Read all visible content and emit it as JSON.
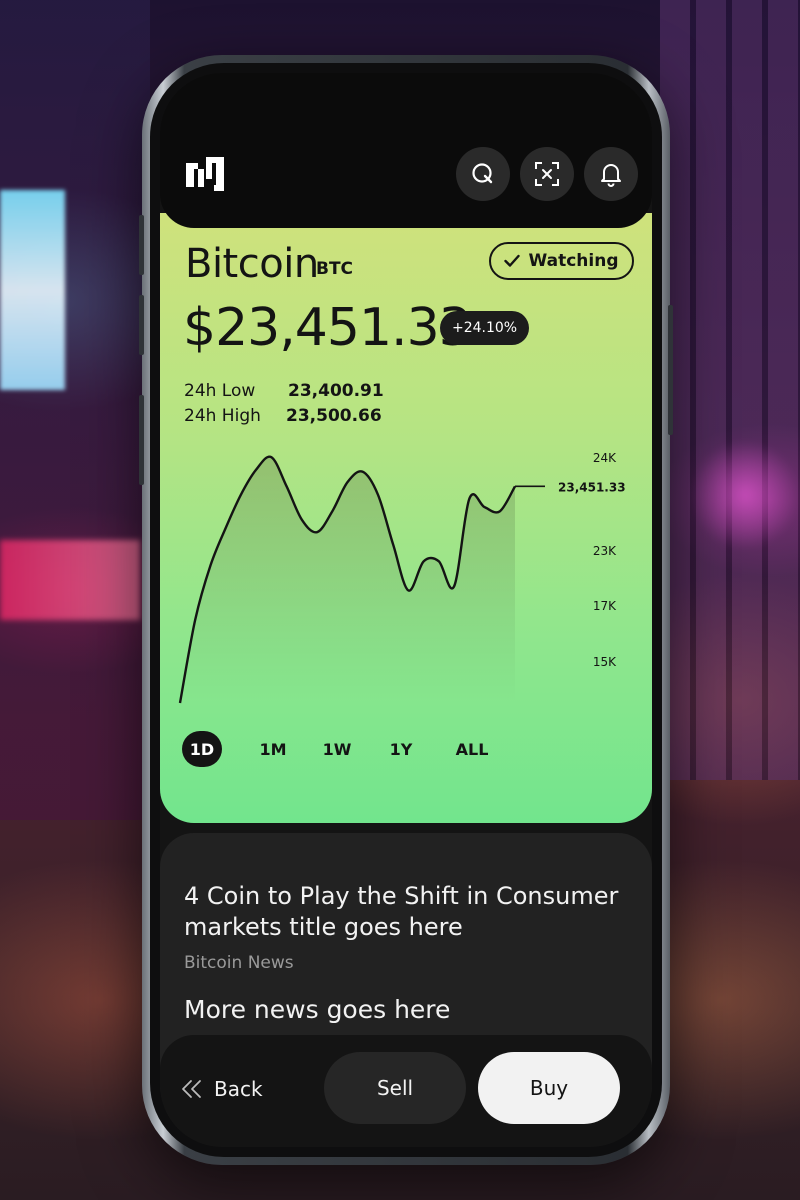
{
  "coin": {
    "name": "Bitcoin",
    "ticker": "BTC",
    "price": "$23,451.33",
    "change": "+24.10%",
    "watch_label": "Watching"
  },
  "stats": {
    "low_label": "24h Low",
    "low_value": "23,400.91",
    "high_label": "24h High",
    "high_value": "23,500.66"
  },
  "top_icons": [
    "search-icon",
    "scan-icon",
    "bell-icon"
  ],
  "ranges": {
    "items": [
      "1D",
      "1M",
      "1W",
      "1Y",
      "ALL"
    ],
    "active": "1D"
  },
  "chart_data": {
    "type": "area",
    "y_tick_labels": [
      "24K",
      "23K",
      "17K",
      "15K"
    ],
    "current_label": "23,451.33",
    "y_index": [
      0.0,
      2.0,
      3.3,
      4.2,
      5.0,
      5.6,
      5.9,
      5.2,
      4.4,
      4.1,
      4.6,
      5.3,
      5.55,
      5.0,
      3.8,
      2.7,
      3.4,
      3.4,
      2.8,
      4.9,
      4.7,
      4.6,
      5.2
    ]
  },
  "news": {
    "title": "4 Coin to Play the Shift in Consumer markets title goes here",
    "source": "Bitcoin News",
    "more": "More news goes here"
  },
  "actions": {
    "back": "Back",
    "sell": "Sell",
    "buy": "Buy"
  },
  "colors": {
    "card_top": "#cfe27c",
    "card_bottom": "#72e58d",
    "dark": "#141414"
  }
}
